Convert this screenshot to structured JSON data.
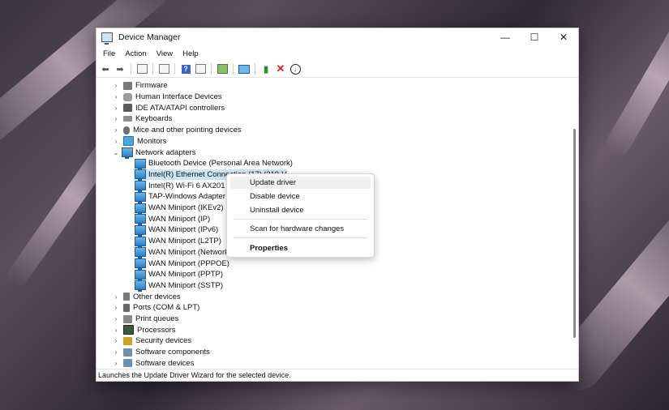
{
  "window": {
    "title": "Device Manager",
    "controls": {
      "minimize": "—",
      "maximize": "☐",
      "close": "✕"
    }
  },
  "menu": [
    "File",
    "Action",
    "View",
    "Help"
  ],
  "tree": [
    {
      "label": "Firmware",
      "expander": "›",
      "icon": "firmware-icon"
    },
    {
      "label": "Human Interface Devices",
      "expander": "›",
      "icon": "hid-icon"
    },
    {
      "label": "IDE ATA/ATAPI controllers",
      "expander": "›",
      "icon": "ide-icon"
    },
    {
      "label": "Keyboards",
      "expander": "›",
      "icon": "keyboard-icon"
    },
    {
      "label": "Mice and other pointing devices",
      "expander": "›",
      "icon": "mouse-icon"
    },
    {
      "label": "Monitors",
      "expander": "›",
      "icon": "monitor-icon"
    },
    {
      "label": "Network adapters",
      "expander": "⌄",
      "icon": "network-icon"
    },
    {
      "label": "Bluetooth Device (Personal Area Network)",
      "child": true
    },
    {
      "label": "Intel(R) Ethernet Connection (17) I219-V",
      "child": true,
      "selected": true
    },
    {
      "label": "Intel(R) Wi-Fi 6 AX201 16",
      "child": true
    },
    {
      "label": "TAP-Windows Adapter V",
      "child": true
    },
    {
      "label": "WAN Miniport (IKEv2)",
      "child": true
    },
    {
      "label": "WAN Miniport (IP)",
      "child": true
    },
    {
      "label": "WAN Miniport (IPv6)",
      "child": true
    },
    {
      "label": "WAN Miniport (L2TP)",
      "child": true
    },
    {
      "label": "WAN Miniport (Network",
      "child": true
    },
    {
      "label": "WAN Miniport (PPPOE)",
      "child": true
    },
    {
      "label": "WAN Miniport (PPTP)",
      "child": true
    },
    {
      "label": "WAN Miniport (SSTP)",
      "child": true
    },
    {
      "label": "Other devices",
      "expander": "›",
      "icon": "other-devices-icon"
    },
    {
      "label": "Ports (COM & LPT)",
      "expander": "›",
      "icon": "ports-icon"
    },
    {
      "label": "Print queues",
      "expander": "›",
      "icon": "printer-icon"
    },
    {
      "label": "Processors",
      "expander": "›",
      "icon": "processor-icon"
    },
    {
      "label": "Security devices",
      "expander": "›",
      "icon": "security-icon"
    },
    {
      "label": "Software components",
      "expander": "›",
      "icon": "software-components-icon"
    },
    {
      "label": "Software devices",
      "expander": "›",
      "icon": "software-devices-icon"
    }
  ],
  "context_menu": {
    "update": "Update driver",
    "disable": "Disable device",
    "uninstall": "Uninstall device",
    "scan": "Scan for hardware changes",
    "properties": "Properties"
  },
  "status_text": "Launches the Update Driver Wizard for the selected device."
}
